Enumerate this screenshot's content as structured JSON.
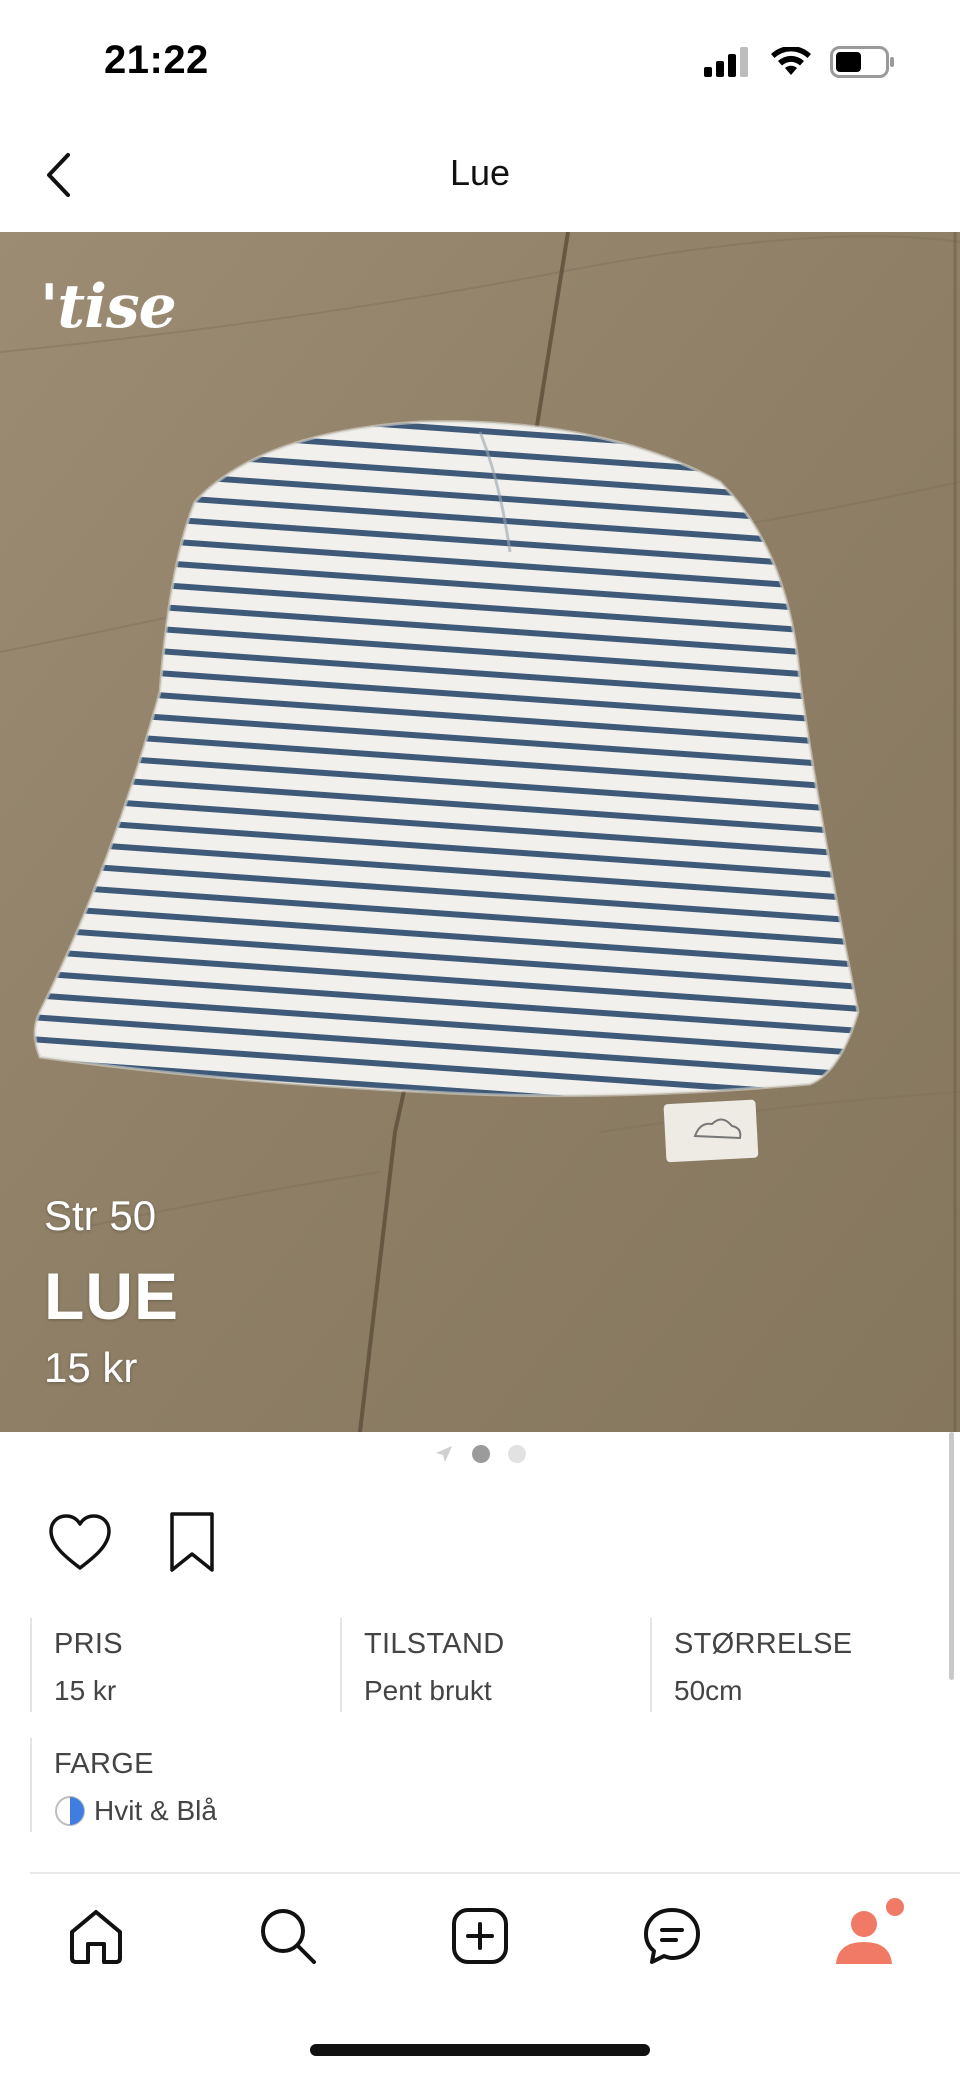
{
  "status_bar": {
    "time": "21:22",
    "icons": [
      "signal-icon",
      "wifi-icon",
      "battery-icon"
    ]
  },
  "header": {
    "title": "Lue",
    "back_icon": "chevron-left-icon"
  },
  "listing": {
    "watermark": "'tise",
    "size_text": "Str 50",
    "title": "LUE",
    "price_text": "15 kr",
    "image_count": 3,
    "active_image": 1
  },
  "actions": {
    "like_icon": "heart-icon",
    "save_icon": "bookmark-icon"
  },
  "details": {
    "price": {
      "label": "PRIS",
      "value": "15 kr"
    },
    "condition": {
      "label": "TILSTAND",
      "value": "Pent brukt"
    },
    "size": {
      "label": "STØRRELSE",
      "value": "50cm"
    },
    "color": {
      "label": "FARGE",
      "value": "Hvit & Blå",
      "swatch": [
        "#ffffff",
        "#3f7de0"
      ]
    }
  },
  "tab_bar": {
    "tabs": [
      {
        "name": "home",
        "icon": "home-icon"
      },
      {
        "name": "search",
        "icon": "search-icon"
      },
      {
        "name": "add",
        "icon": "plus-square-icon"
      },
      {
        "name": "messages",
        "icon": "chat-icon"
      },
      {
        "name": "profile",
        "icon": "profile-icon",
        "active": true,
        "has_notification": true
      }
    ],
    "accent": "#f07a65"
  }
}
